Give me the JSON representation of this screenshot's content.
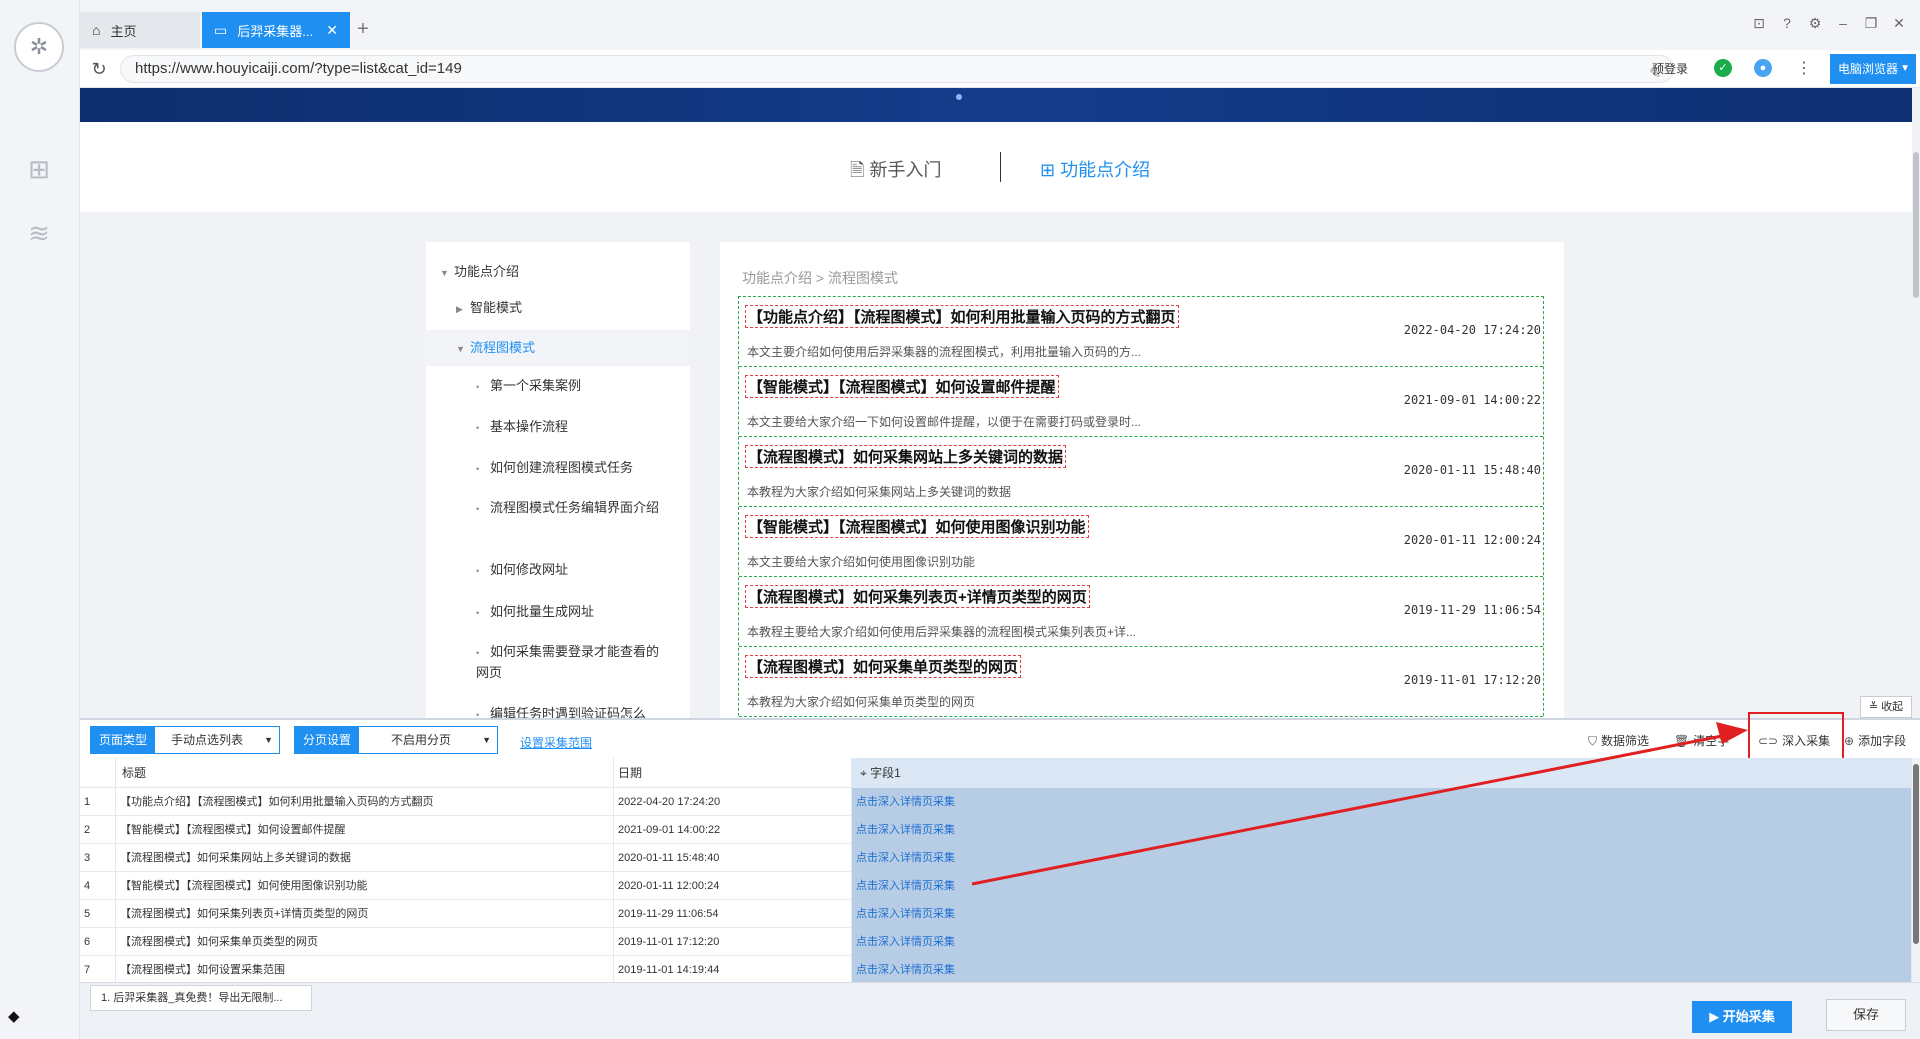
{
  "tabs": {
    "home_label": "主页",
    "active_label": "后羿采集器...",
    "add": "+"
  },
  "address": {
    "url": "https://www.houyicaiji.com/?type=list&cat_id=149",
    "pre_login": "预登录",
    "browser_mode": "电脑浏览器"
  },
  "site": {
    "nav": [
      {
        "label": "新手入门",
        "icon": "document-icon"
      },
      {
        "label": "功能点介绍",
        "icon": "grid-icon"
      }
    ],
    "menu": [
      {
        "label": "功能点介绍",
        "level": 0,
        "caret": "▼"
      },
      {
        "label": "智能模式",
        "level": 1,
        "caret": "▶"
      },
      {
        "label": "流程图模式",
        "level": 1,
        "caret": "▼",
        "selected": true
      },
      {
        "label": "第一个采集案例",
        "level": 2,
        "caret": "•"
      },
      {
        "label": "基本操作流程",
        "level": 2,
        "caret": "•"
      },
      {
        "label": "如何创建流程图模式任务",
        "level": 2,
        "caret": "•"
      },
      {
        "label": "流程图模式任务编辑界面介绍",
        "level": 2,
        "caret": "•"
      },
      {
        "label": "如何修改网址",
        "level": 2,
        "caret": "•"
      },
      {
        "label": "如何批量生成网址",
        "level": 2,
        "caret": "•"
      },
      {
        "label": "如何采集需要登录才能查看的网页",
        "level": 2,
        "caret": "•"
      },
      {
        "label": "编辑任务时遇到验证码怎么",
        "level": 2,
        "caret": "•"
      }
    ],
    "breadcrumb": "功能点介绍 > 流程图模式",
    "articles": [
      {
        "title": "【功能点介绍】【流程图模式】如何利用批量输入页码的方式翻页",
        "date": "2022-04-20 17:24:20",
        "excerpt": "本文主要介绍如何使用后羿采集器的流程图模式，利用批量输入页码的方..."
      },
      {
        "title": "【智能模式】【流程图模式】如何设置邮件提醒",
        "date": "2021-09-01 14:00:22",
        "excerpt": "本文主要给大家介绍一下如何设置邮件提醒，以便于在需要打码或登录时..."
      },
      {
        "title": "【流程图模式】如何采集网站上多关键词的数据",
        "date": "2020-01-11 15:48:40",
        "excerpt": "本教程为大家介绍如何采集网站上多关键词的数据"
      },
      {
        "title": "【智能模式】【流程图模式】如何使用图像识别功能",
        "date": "2020-01-11 12:00:24",
        "excerpt": "本文主要给大家介绍如何使用图像识别功能"
      },
      {
        "title": "【流程图模式】如何采集列表页+详情页类型的网页",
        "date": "2019-11-29 11:06:54",
        "excerpt": "本教程主要给大家介绍如何使用后羿采集器的流程图模式采集列表页+详..."
      },
      {
        "title": "【流程图模式】如何采集单页类型的网页",
        "date": "2019-11-01 17:12:20",
        "excerpt": "本教程为大家介绍如何采集单页类型的网页"
      }
    ]
  },
  "panel": {
    "collapse": "收起",
    "page_type_label": "页面类型",
    "page_type_value": "手动点选列表",
    "paging_label": "分页设置",
    "paging_value": "不启用分页",
    "range_link": "设置采集范围",
    "actions": {
      "filter": "数据筛选",
      "clear": "清空字",
      "deep": "深入采集",
      "add_field": "添加字段"
    },
    "columns": [
      "",
      "标题",
      "日期",
      "字段1"
    ],
    "rows": [
      {
        "n": "1",
        "title": "【功能点介绍】【流程图模式】如何利用批量输入页码的方式翻页",
        "date": "2022-04-20 17:24:20",
        "field": "点击深入详情页采集"
      },
      {
        "n": "2",
        "title": "【智能模式】【流程图模式】如何设置邮件提醒",
        "date": "2021-09-01 14:00:22",
        "field": "点击深入详情页采集"
      },
      {
        "n": "3",
        "title": "【流程图模式】如何采集网站上多关键词的数据",
        "date": "2020-01-11 15:48:40",
        "field": "点击深入详情页采集"
      },
      {
        "n": "4",
        "title": "【智能模式】【流程图模式】如何使用图像识别功能",
        "date": "2020-01-11 12:00:24",
        "field": "点击深入详情页采集"
      },
      {
        "n": "5",
        "title": "【流程图模式】如何采集列表页+详情页类型的网页",
        "date": "2019-11-29 11:06:54",
        "field": "点击深入详情页采集"
      },
      {
        "n": "6",
        "title": "【流程图模式】如何采集单页类型的网页",
        "date": "2019-11-01 17:12:20",
        "field": "点击深入详情页采集"
      },
      {
        "n": "7",
        "title": "【流程图模式】如何设置采集范围",
        "date": "2019-11-01 14:19:44",
        "field": "点击深入详情页采集"
      }
    ],
    "notice": "1. 后羿采集器_真免费！导出无限制...",
    "start": "开始采集",
    "save": "保存"
  },
  "colors": {
    "accent": "#1f8ff2",
    "annotation": "#e02020",
    "field_column": "#b7cde6"
  }
}
